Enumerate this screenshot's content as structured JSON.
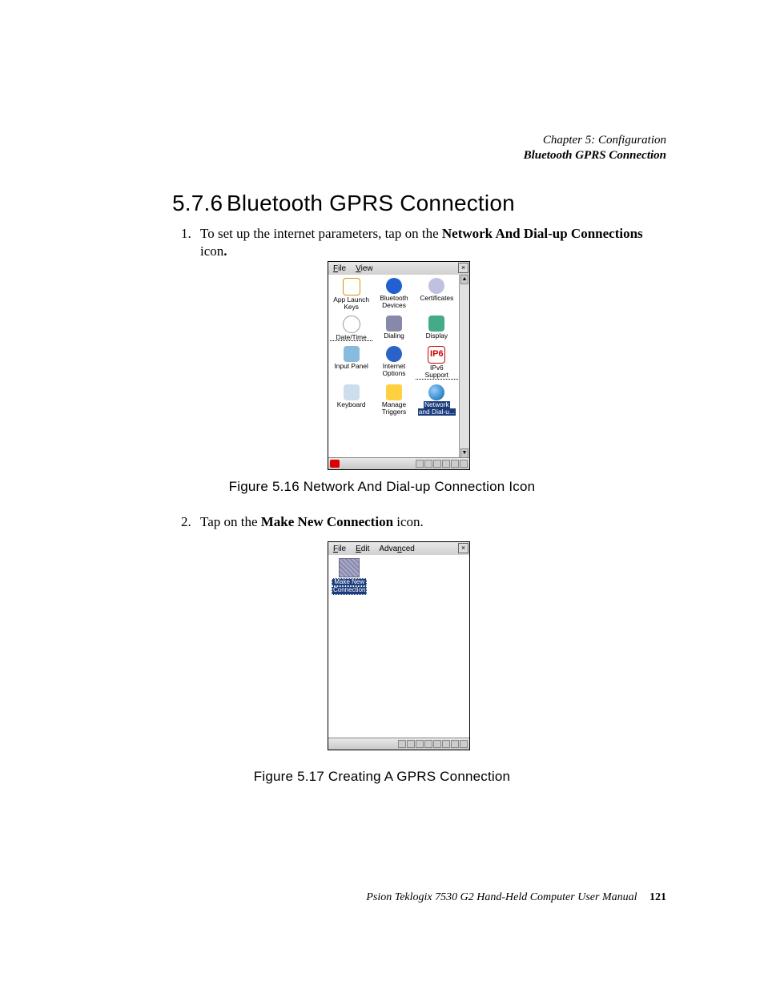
{
  "header": {
    "chapter_line": "Chapter  5:  Configuration",
    "topic_line": "Bluetooth GPRS Connection"
  },
  "section": {
    "number": "5.7.6",
    "title": "Bluetooth GPRS Connection"
  },
  "steps": {
    "s1_num": "1.",
    "s1_a": "To set up the internet parameters, tap on the ",
    "s1_b": "Network And Dial-up Connections",
    "s1_c": " icon",
    "s1_d": ".",
    "s2_num": "2.",
    "s2_a": "Tap on the ",
    "s2_b": "Make New Connection",
    "s2_c": " icon."
  },
  "fig1": {
    "caption": "Figure 5.16 Network And Dial-up Connection Icon",
    "menu": {
      "file": "File",
      "view": "View",
      "close": "×"
    },
    "icons": [
      {
        "label1": "App Launch",
        "label2": "Keys",
        "cls": "app"
      },
      {
        "label1": "Bluetooth",
        "label2": "Devices",
        "cls": "bt"
      },
      {
        "label1": "Certificates",
        "label2": "",
        "cls": "cert"
      },
      {
        "label1": "Date/Time",
        "label2": "",
        "cls": "clock",
        "dotline": true
      },
      {
        "label1": "Dialing",
        "label2": "",
        "cls": "dial"
      },
      {
        "label1": "Display",
        "label2": "",
        "cls": "disp"
      },
      {
        "label1": "Input Panel",
        "label2": "",
        "cls": "inp"
      },
      {
        "label1": "Internet",
        "label2": "Options",
        "cls": "ie"
      },
      {
        "label1": "IPv6",
        "label2": "Support",
        "cls": "ipv",
        "iptext": "IP6"
      },
      {
        "label1": "Keyboard",
        "label2": "",
        "cls": "kbd"
      },
      {
        "label1": "Manage",
        "label2": "Triggers",
        "cls": "mg"
      },
      {
        "label1": "Network",
        "label2": "and Dial-u...",
        "cls": "net",
        "selected": true
      }
    ],
    "scroll": {
      "up": "▲",
      "down": "▼"
    }
  },
  "fig2": {
    "caption": "Figure 5.17 Creating A GPRS Connection",
    "menu": {
      "file": "File",
      "edit": "Edit",
      "adv": "Advanced",
      "close": "×"
    },
    "icon": {
      "l1": "Make New",
      "l2": "Connection"
    }
  },
  "footer": {
    "text": "Psion Teklogix 7530 G2 Hand-Held Computer User Manual",
    "page": "121"
  }
}
